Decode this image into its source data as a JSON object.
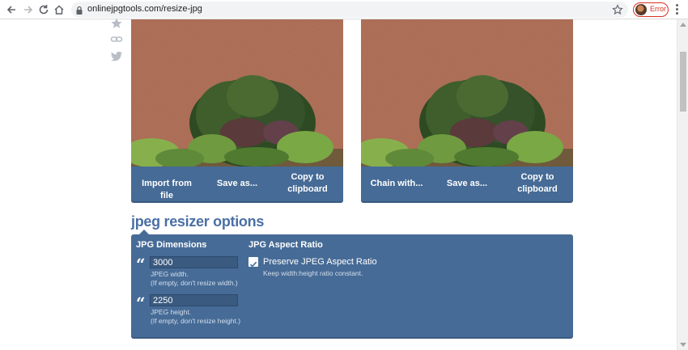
{
  "browser": {
    "url": "onlinejpgtools.com/resize-jpg",
    "profile_status": "Error"
  },
  "panels": {
    "input": {
      "buttons": [
        "Import from file",
        "Save as...",
        "Copy to clipboard"
      ]
    },
    "output": {
      "buttons": [
        "Chain with...",
        "Save as...",
        "Copy to clipboard"
      ]
    }
  },
  "options": {
    "heading": "jpeg resizer options",
    "dimensions": {
      "title": "JPG Dimensions",
      "width_value": "3000",
      "width_hint_1": "JPEG width.",
      "width_hint_2": "(If empty, don't resize width.)",
      "height_value": "2250",
      "height_hint_1": "JPEG height.",
      "height_hint_2": "(If empty, don't resize height.)"
    },
    "aspect": {
      "title": "JPG Aspect Ratio",
      "checkbox_label": "Preserve JPEG Aspect Ratio",
      "checkbox_checked": true,
      "hint": "Keep width:height ratio constant."
    }
  },
  "colors": {
    "panel_blue": "#466b96",
    "heading_blue": "#4a6fa5",
    "error_red": "#d93025"
  }
}
